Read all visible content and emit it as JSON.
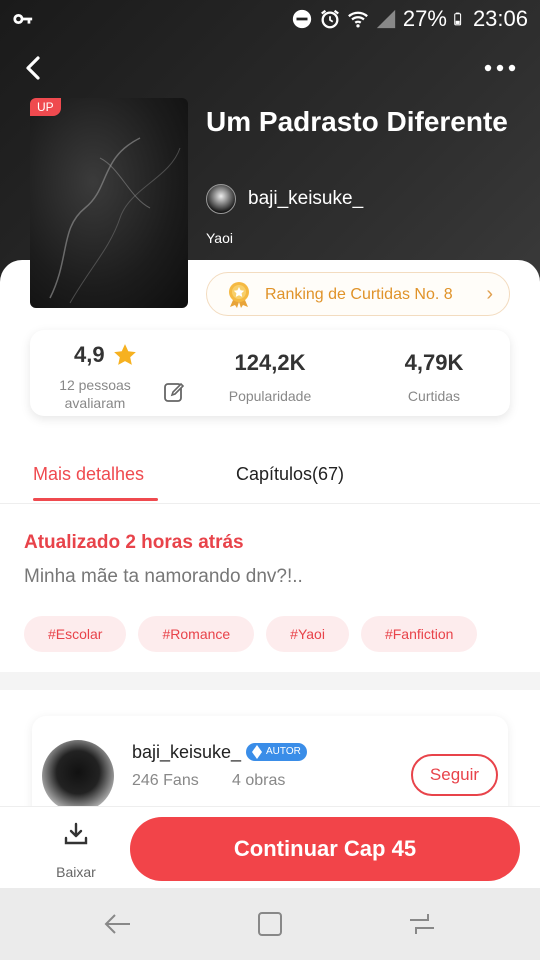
{
  "status_bar": {
    "battery": "27%",
    "time": "23:06",
    "icons": [
      "key-icon",
      "dnd-icon",
      "alarm-icon",
      "wifi-icon",
      "signal-icon",
      "battery-icon"
    ]
  },
  "nav": {
    "back_icon": "chevron-left-icon",
    "more_icon": "more-dots-icon"
  },
  "book": {
    "badge": "UP",
    "title": "Um Padrasto Diferente",
    "author": "baji_keisuke_",
    "genre": "Yaoi",
    "ranking": "Ranking de Curtidas No. 8"
  },
  "stats": {
    "rating": "4,9",
    "rating_sub": "12 pessoas avaliaram",
    "popularity_value": "124,2K",
    "popularity_label": "Popularidade",
    "likes_value": "4,79K",
    "likes_label": "Curtidas"
  },
  "tabs": [
    {
      "label": "Mais detalhes",
      "active": true
    },
    {
      "label": "Capítulos(67)",
      "active": false
    }
  ],
  "details": {
    "updated": "Atualizado 2 horas atrás",
    "description": "Minha mãe ta namorando dnv?!..",
    "tags": [
      "#Escolar",
      "#Romance",
      "#Yaoi",
      "#Fanfiction"
    ]
  },
  "author_card": {
    "name": "baji_keisuke_",
    "badge": "AUTOR",
    "fans": "246 Fans",
    "works": "4 obras",
    "follow_label": "Seguir"
  },
  "action_bar": {
    "download_label": "Baixar",
    "continue_label": "Continuar Cap 45"
  },
  "colors": {
    "accent": "#f24449",
    "ranking": "#e0932a",
    "autor_badge": "#3a8de8"
  }
}
